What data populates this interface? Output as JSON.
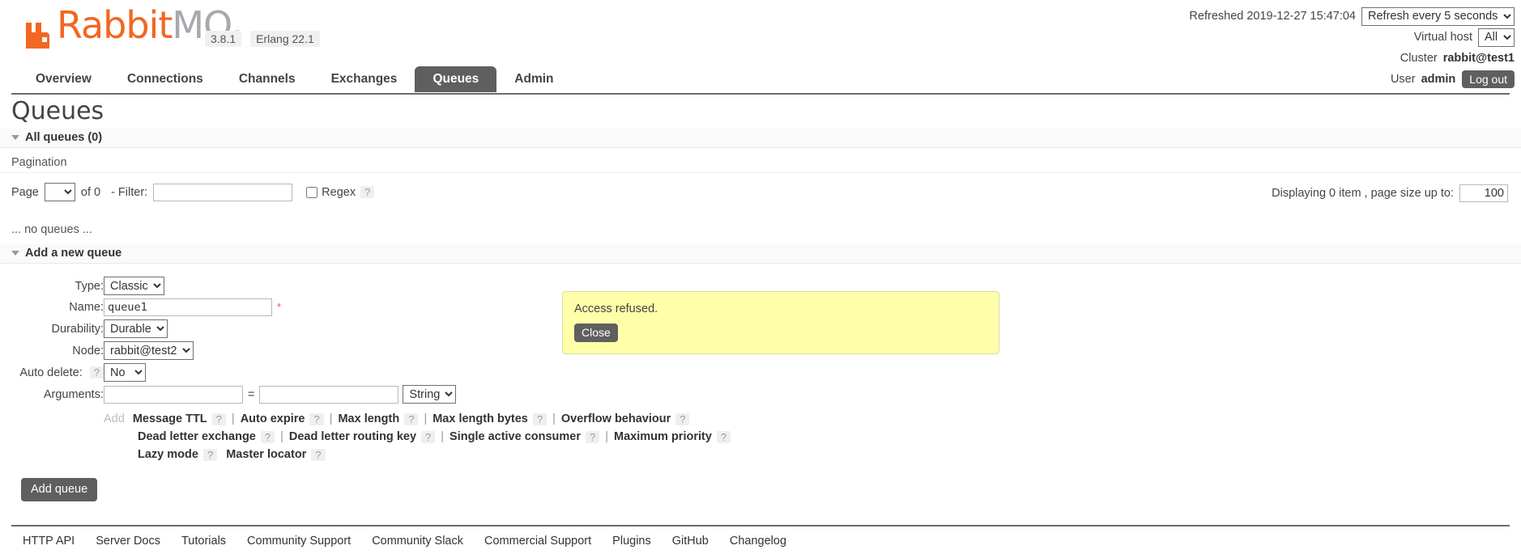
{
  "brand": {
    "name_primary": "Rabbit",
    "name_secondary": "MQ",
    "trademark": "®",
    "version": "3.8.1",
    "erlang": "Erlang 22.1"
  },
  "header": {
    "refreshed_label": "Refreshed 2019-12-27 15:47:04",
    "refresh_select": "Refresh every 5 seconds",
    "vhost_label": "Virtual host",
    "vhost_select": "All",
    "cluster_label": "Cluster",
    "cluster_name": "rabbit@test1",
    "user_label": "User",
    "user_name": "admin",
    "logout_label": "Log out"
  },
  "nav": {
    "tabs": [
      {
        "label": "Overview",
        "active": false
      },
      {
        "label": "Connections",
        "active": false
      },
      {
        "label": "Channels",
        "active": false
      },
      {
        "label": "Exchanges",
        "active": false
      },
      {
        "label": "Queues",
        "active": true
      },
      {
        "label": "Admin",
        "active": false
      }
    ]
  },
  "page": {
    "title": "Queues",
    "all_queues_header": "All queues (0)",
    "pagination_label": "Pagination",
    "page_label": "Page",
    "page_value": "",
    "of_label": "of 0",
    "filter_label": "- Filter:",
    "filter_value": "",
    "filter_placeholder": "",
    "regex_label": "Regex",
    "regex_checked": false,
    "help_glyph": "?",
    "displaying_label": "Displaying 0 item , page size up to:",
    "page_size_value": "100",
    "no_queues_text": "... no queues ..."
  },
  "alert": {
    "message": "Access refused.",
    "close_label": "Close"
  },
  "add_queue": {
    "section_title": "Add a new queue",
    "type_label": "Type:",
    "type_value": "Classic",
    "name_label": "Name:",
    "name_value": "queue1",
    "durability_label": "Durability:",
    "durability_value": "Durable",
    "node_label": "Node:",
    "node_value": "rabbit@test2",
    "auto_delete_label": "Auto delete:",
    "auto_delete_value": "No",
    "arguments_label": "Arguments:",
    "arg_key_value": "",
    "arg_val_value": "",
    "arg_equals": "=",
    "arg_type_value": "String",
    "add_label": "Add",
    "presets_row1": [
      "Message TTL",
      "Auto expire",
      "Max length",
      "Max length bytes",
      "Overflow behaviour"
    ],
    "presets_row2": [
      "Dead letter exchange",
      "Dead letter routing key",
      "Single active consumer",
      "Maximum priority"
    ],
    "presets_row3": [
      "Lazy mode",
      "Master locator"
    ],
    "submit_label": "Add queue"
  },
  "footer": {
    "links": [
      "HTTP API",
      "Server Docs",
      "Tutorials",
      "Community Support",
      "Community Slack",
      "Commercial Support",
      "Plugins",
      "GitHub",
      "Changelog"
    ]
  },
  "colors": {
    "brand_orange": "#f26722",
    "brand_gray": "#a7a9ac",
    "dark_button": "#5f5f5f",
    "alert_yellow": "#ffffaa",
    "required_red": "#ff5555"
  }
}
